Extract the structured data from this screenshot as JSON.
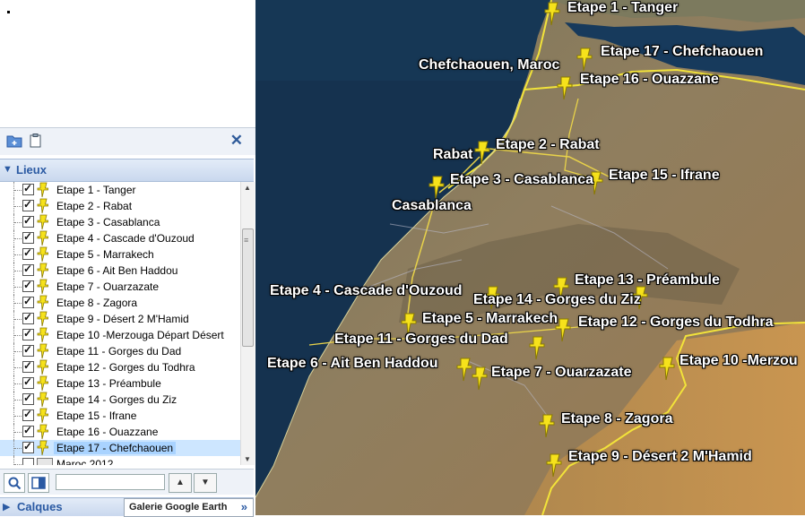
{
  "sidebar": {
    "lieux_title": "Lieux",
    "calques_title": "Calques",
    "gallery_button": "Galerie Google Earth",
    "gallery_chevron": "»",
    "up_arrow": "▲",
    "down_arrow": "▼",
    "close_symbol": "✕",
    "items": [
      {
        "label": "Etape 1 - Tanger",
        "checked": true
      },
      {
        "label": "Etape 2 - Rabat",
        "checked": true
      },
      {
        "label": "Etape 3 - Casablanca",
        "checked": true
      },
      {
        "label": "Etape 4 - Cascade d'Ouzoud",
        "checked": true
      },
      {
        "label": "Etape 5 - Marrakech",
        "checked": true
      },
      {
        "label": "Etape 6 - Ait Ben Haddou",
        "checked": true
      },
      {
        "label": "Etape 7 - Ouarzazate",
        "checked": true
      },
      {
        "label": "Etape 8 - Zagora",
        "checked": true
      },
      {
        "label": "Etape 9 - Désert 2 M'Hamid",
        "checked": true
      },
      {
        "label": "Etape 10 -Merzouga Départ Désert",
        "checked": true
      },
      {
        "label": "Etape 11 - Gorges du Dad",
        "checked": true
      },
      {
        "label": "Etape 12 - Gorges du Todhra",
        "checked": true
      },
      {
        "label": "Etape 13 - Préambule",
        "checked": true
      },
      {
        "label": "Etape 14 - Gorges du Ziz",
        "checked": true
      },
      {
        "label": "Etape 15 - Ifrane",
        "checked": true
      },
      {
        "label": "Etape 16 - Ouazzane",
        "checked": true
      },
      {
        "label": "Etape 17 - Chefchaouen",
        "checked": true,
        "selected": true
      },
      {
        "label": "Maroc 2012",
        "checked": false,
        "folder": true
      }
    ]
  },
  "map": {
    "labels": {
      "e1": "Etape 1 - Tanger",
      "e17": "Etape 17 - Chefchaouen",
      "chef": "Chefchaouen, Maroc",
      "e16": "Etape 16 - Ouazzane",
      "rabat": "Rabat",
      "e2": "Etape 2 - Rabat",
      "e3": "Etape 3 - Casablanca",
      "e15": "Etape 15 - Ifrane",
      "casa": "Casablanca",
      "e13": "Etape 13 - Préambule",
      "e4": "Etape 4 - Cascade d'Ouzoud",
      "e14": "Etape 14 - Gorges du Ziz",
      "e5": "Etape 5 - Marrakech",
      "e12": "Etape 12 - Gorges du Todhra",
      "e11": "Etape 11 - Gorges du Dad",
      "e10": "Etape 10 -Merzou",
      "e6": "Etape 6 - Ait Ben Haddou",
      "e7": "Etape 7 - Ouarzazate",
      "e8": "Etape 8 - Zagora",
      "e9": "Etape 9 - Désert 2 M'Hamid"
    }
  },
  "colors": {
    "ocean": "#15324f",
    "land": "#8b7a5c",
    "border": "#f2e33a",
    "pin": "#f6e21b",
    "selection": "#cde6ff"
  }
}
